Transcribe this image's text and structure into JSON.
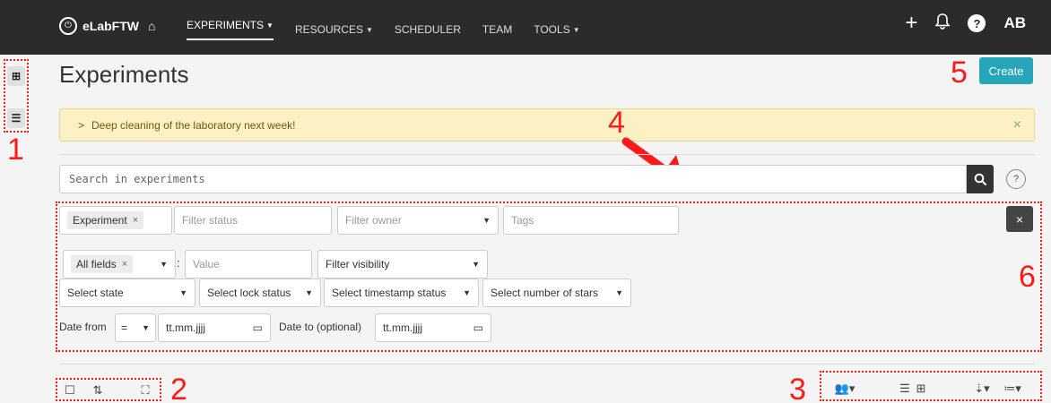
{
  "navbar": {
    "brand": "eLabFTW",
    "items": [
      {
        "label": "EXPERIMENTS",
        "dropdown": true,
        "active": true
      },
      {
        "label": "RESOURCES",
        "dropdown": true
      },
      {
        "label": "SCHEDULER",
        "dropdown": false
      },
      {
        "label": "TEAM",
        "dropdown": false
      },
      {
        "label": "TOOLS",
        "dropdown": true
      }
    ],
    "avatar_initials": "AB",
    "icons": [
      "home-icon",
      "plus-icon",
      "bell-icon",
      "help-icon"
    ]
  },
  "page": {
    "title": "Experiments",
    "create_label": "Create"
  },
  "alert": {
    "text": "Deep cleaning of the laboratory next week!"
  },
  "search": {
    "placeholder": "Search in experiments"
  },
  "filters": {
    "category_chip": "Experiment",
    "status_placeholder": "Filter status",
    "owner_placeholder": "Filter owner",
    "tags_placeholder": "Tags",
    "fields_chip": "All fields",
    "value_placeholder": "Value",
    "visibility_placeholder": "Filter visibility",
    "state_placeholder": "Select state",
    "lock_placeholder": "Select lock status",
    "timestamp_placeholder": "Select timestamp status",
    "stars_placeholder": "Select number of stars",
    "date_from_label": "Date from",
    "date_operator": "=",
    "date_placeholder": "tt.mm.jjjj",
    "date_to_label": "Date to (optional)"
  },
  "annotations": {
    "numbers": [
      "1",
      "2",
      "3",
      "4",
      "5",
      "6"
    ],
    "color": "#ff1a1a"
  },
  "colors": {
    "navbar": "#2b2b2b",
    "create_button": "#26a6b8",
    "alert_bg": "#fcf1c4"
  }
}
